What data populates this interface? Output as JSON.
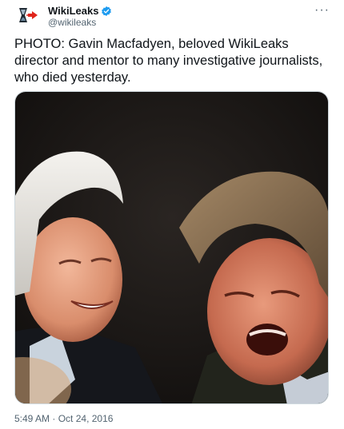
{
  "tweet": {
    "display_name": "WikiLeaks",
    "handle": "@wikileaks",
    "verified_icon": "verified-badge-icon",
    "more_icon": "more-dots-icon",
    "text": "PHOTO: Gavin Macfadyen, beloved WikiLeaks director and mentor to many investigative journalists, who died yesterday.",
    "time": "5:49 AM",
    "separator": "·",
    "date": "Oct 24, 2016"
  },
  "colors": {
    "verified_blue": "#1d9bf0",
    "secondary_text": "#536471",
    "logo_red": "#e0241b"
  }
}
